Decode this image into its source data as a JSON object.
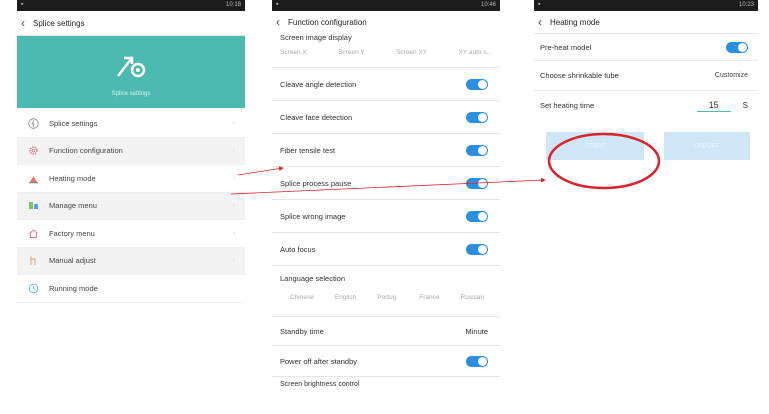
{
  "colors": {
    "teal": "#4cbab0",
    "toggle_blue": "#2b8fe0",
    "status_bar": "#1c1c1c",
    "annotation_red": "#d9232d",
    "button_light_blue": "#cfe6f6"
  },
  "screen1": {
    "status_time": "10:18",
    "title": "Splice settings",
    "banner_label": "Splice settings",
    "banner_icon": "gear-wrench-icon",
    "menu": [
      {
        "label": "Splice settings",
        "icon": "lightning-icon"
      },
      {
        "label": "Function configuration",
        "icon": "gear-icon"
      },
      {
        "label": "Heating mode",
        "icon": "heater-icon"
      },
      {
        "label": "Manage menu",
        "icon": "manage-icon"
      },
      {
        "label": "Factory menu",
        "icon": "home-icon"
      },
      {
        "label": "Manual adjust",
        "icon": "adjust-icon"
      },
      {
        "label": "Running mode",
        "icon": "running-icon"
      }
    ]
  },
  "screen2": {
    "status_time": "10:46",
    "title": "Function configuration",
    "screen_image_display": {
      "label": "Screen image display",
      "options": [
        "Screen X",
        "Screen Y",
        "Screen XY",
        "XY auto s..."
      ]
    },
    "toggles": [
      {
        "label": "Cleave angle detection",
        "on": true
      },
      {
        "label": "Cleave face detection",
        "on": true
      },
      {
        "label": "Fiber tensile test",
        "on": true
      },
      {
        "label": "Splice process pause",
        "on": true
      },
      {
        "label": "Splice wrong image",
        "on": true
      },
      {
        "label": "Auto focus",
        "on": true
      }
    ],
    "language": {
      "label": "Language selection",
      "options": [
        "Chinese",
        "English",
        "Portug.",
        "France",
        "Russian"
      ]
    },
    "standby": {
      "label": "Standby time",
      "value": "Minute"
    },
    "power_off": {
      "label": "Power off after standby",
      "on": true
    },
    "brightness": {
      "label": "Screen brightness control"
    }
  },
  "screen3": {
    "status_time": "10:23",
    "title": "Heating mode",
    "preheat": {
      "label": "Pre-heat model",
      "on": true
    },
    "tube": {
      "label": "Choose shrinkable tube",
      "value": "Customize"
    },
    "heating_time": {
      "label": "Set heating time",
      "value": "15",
      "unit": "S"
    },
    "start_label": "START",
    "stop_label": "ON/OFF"
  }
}
